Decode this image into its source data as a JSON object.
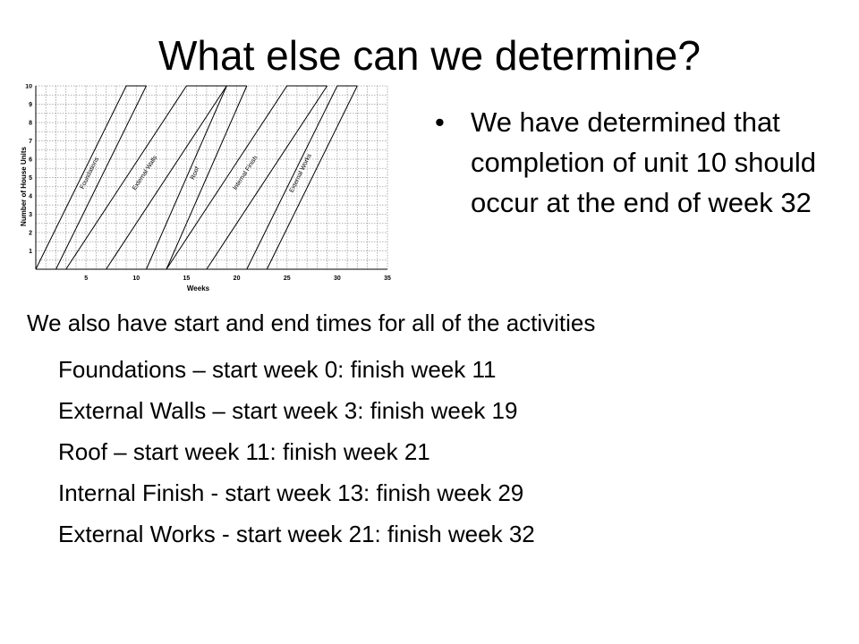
{
  "slide": {
    "title": "What else can we determine?",
    "bullet_symbol": "•",
    "bullet": "We have determined that completion of unit 10 should occur at the end of week 32",
    "intro": "We also have start and end times for all of the activities",
    "activities": [
      "Foundations – start week 0: finish week 11",
      "External Walls – start week 3: finish week 19",
      "Roof – start week 11: finish week 21",
      "Internal Finish - start week 13: finish week 29",
      "External Works - start week 21: finish week 32"
    ]
  },
  "chart_data": {
    "type": "line",
    "xlabel": "Weeks",
    "ylabel": "Number of House Units",
    "xlim": [
      0,
      35
    ],
    "ylim": [
      0,
      10
    ],
    "x_ticks": [
      5,
      10,
      15,
      20,
      25,
      30,
      35
    ],
    "y_ticks": [
      1,
      2,
      3,
      4,
      5,
      6,
      7,
      8,
      9,
      10
    ],
    "grid": true,
    "series": [
      {
        "name": "Foundations",
        "lines": [
          [
            [
              0,
              0
            ],
            [
              9,
              10
            ],
            [
              11,
              10
            ]
          ],
          [
            [
              2,
              0
            ],
            [
              11,
              10
            ]
          ]
        ]
      },
      {
        "name": "External Walls",
        "lines": [
          [
            [
              3,
              0
            ],
            [
              15,
              10
            ],
            [
              19,
              10
            ]
          ],
          [
            [
              7,
              0
            ],
            [
              19,
              10
            ]
          ]
        ]
      },
      {
        "name": "Roof",
        "lines": [
          [
            [
              11,
              0
            ],
            [
              19,
              10
            ],
            [
              21,
              10
            ]
          ],
          [
            [
              13,
              0
            ],
            [
              21,
              10
            ]
          ]
        ]
      },
      {
        "name": "Internal Finish",
        "lines": [
          [
            [
              13,
              0
            ],
            [
              25,
              10
            ],
            [
              29,
              10
            ]
          ],
          [
            [
              17,
              0
            ],
            [
              29,
              10
            ]
          ]
        ]
      },
      {
        "name": "External Works",
        "lines": [
          [
            [
              21,
              0
            ],
            [
              30,
              10
            ],
            [
              32,
              10
            ]
          ],
          [
            [
              23,
              0
            ],
            [
              32,
              10
            ]
          ]
        ]
      }
    ]
  }
}
